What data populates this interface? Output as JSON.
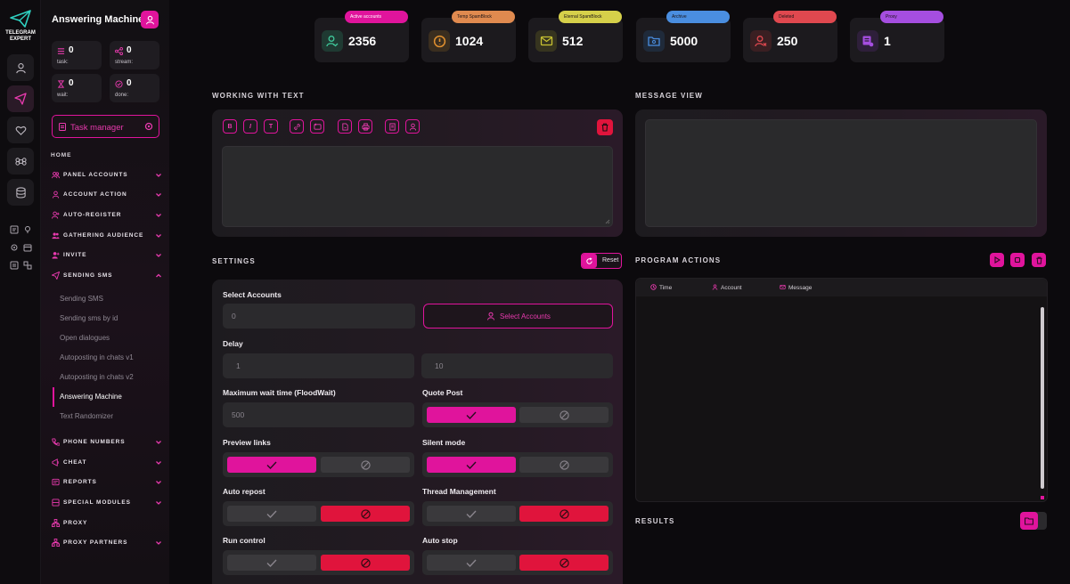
{
  "app": {
    "brand_line1": "TELEGRAM",
    "brand_line2": "EXPERT",
    "page_title": "Answering Machine"
  },
  "counters": [
    {
      "value": "0",
      "label": "task:"
    },
    {
      "value": "0",
      "label": "stream:"
    },
    {
      "value": "0",
      "label": "wait:"
    },
    {
      "value": "0",
      "label": "done:"
    }
  ],
  "task_manager_label": "Task manager",
  "nav": {
    "home": "HOME",
    "items": [
      {
        "label": "PANEL ACCOUNTS",
        "icon": "users-icon"
      },
      {
        "label": "ACCOUNT ACTION",
        "icon": "user-icon"
      },
      {
        "label": "AUTO-REGISTER",
        "icon": "user-plus-icon"
      },
      {
        "label": "GATHERING AUDIENCE",
        "icon": "users-group-icon"
      },
      {
        "label": "INVITE",
        "icon": "user-add-icon"
      },
      {
        "label": "SENDING SMS",
        "icon": "send-icon"
      },
      {
        "label": "PHONE NUMBERS",
        "icon": "phone-icon"
      },
      {
        "label": "CHEAT",
        "icon": "megaphone-icon"
      },
      {
        "label": "REPORTS",
        "icon": "report-icon"
      },
      {
        "label": "SPECIAL MODULES",
        "icon": "modules-icon"
      },
      {
        "label": "PROXY",
        "icon": "proxy-icon"
      },
      {
        "label": "PROXY PARTNERS",
        "icon": "network-icon"
      }
    ],
    "sub_items": [
      "Sending SMS",
      "Sending sms by id",
      "Open dialogues",
      "Autoposting in chats v1",
      "Autoposting in chats v2",
      "Answering Machine",
      "Text Randomizer"
    ],
    "active_sub": "Answering Machine"
  },
  "stats": [
    {
      "tag": "Active accounts",
      "value": "2356",
      "tag_color": "#e0149c",
      "icon_color": "#3fc89a",
      "icon": "user-check-icon"
    },
    {
      "tag": "Temp SpamBlock",
      "value": "1024",
      "tag_color": "#e08a4f",
      "icon_color": "#e0902f",
      "icon": "alert-circle-icon"
    },
    {
      "tag": "Eternal SpamBlock",
      "value": "512",
      "tag_color": "#d6d04a",
      "icon_color": "#c8c232",
      "icon": "mail-block-icon"
    },
    {
      "tag": "Archive",
      "value": "5000",
      "tag_color": "#4a8ee0",
      "icon_color": "#4a8ee0",
      "icon": "archive-icon"
    },
    {
      "tag": "Deleted",
      "value": "250",
      "tag_color": "#e0484f",
      "icon_color": "#e0484f",
      "icon": "user-x-icon"
    },
    {
      "tag": "Proxy",
      "value": "1",
      "tag_color": "#a54ee0",
      "icon_color": "#a54ee0",
      "icon": "proxy-list-icon"
    }
  ],
  "sections": {
    "working_text": "WORKING WITH TEXT",
    "message_view": "MESSAGE VIEW",
    "settings": "SETTINGS",
    "program_actions": "PROGRAM ACTIONS",
    "results": "RESULTS"
  },
  "toolbar": [
    "B",
    "I",
    "T"
  ],
  "settings": {
    "reset_label": "Reset",
    "select_accounts_label": "Select Accounts",
    "select_accounts_value": "0",
    "select_accounts_button": "Select Accounts",
    "delay_label": "Delay",
    "delay_from": "1",
    "delay_to": "10",
    "max_wait_label": "Maximum wait time (FloodWait)",
    "max_wait_value": "500",
    "quote_post_label": "Quote Post",
    "preview_links_label": "Preview links",
    "silent_mode_label": "Silent mode",
    "auto_repost_label": "Auto repost",
    "thread_mgmt_label": "Thread Management",
    "run_control_label": "Run control",
    "auto_stop_label": "Auto stop"
  },
  "log_columns": [
    "Time",
    "Account",
    "Message"
  ],
  "colors": {
    "accent": "#e0149c",
    "danger": "#e0143c"
  }
}
